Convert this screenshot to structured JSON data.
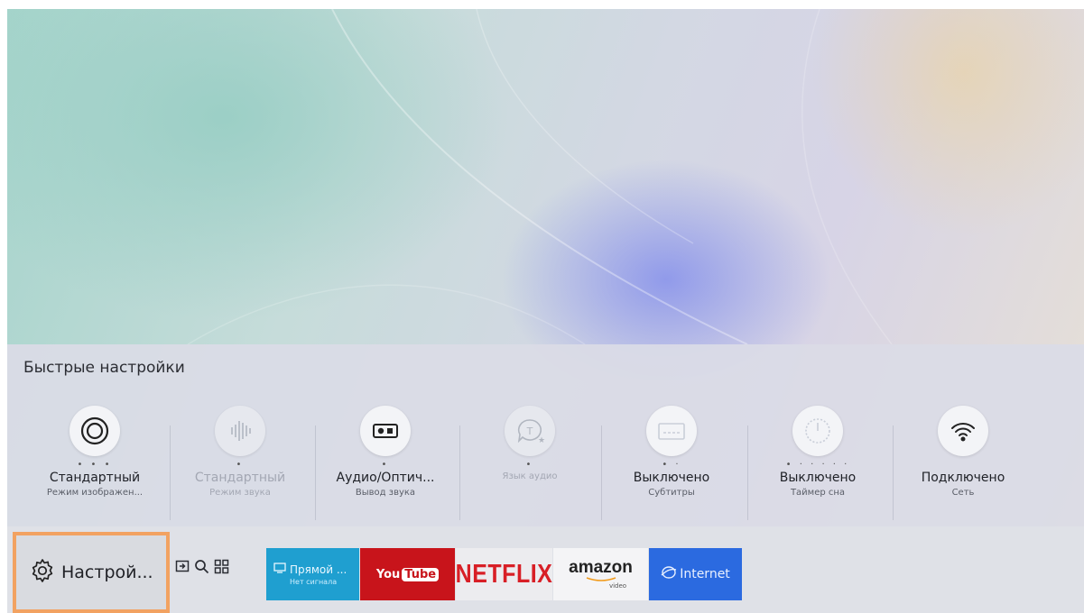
{
  "quick_settings": {
    "title": "Быстрые настройки",
    "items": [
      {
        "value": "Стандартный",
        "label": "Режим изображен...",
        "icon": "picture-mode-icon",
        "dots": "• • •"
      },
      {
        "value": "Стандартный",
        "label": "Режим звука",
        "icon": "sound-mode-icon",
        "dots": "•"
      },
      {
        "value": "Аудио/Оптич...",
        "label": "Вывод звука",
        "icon": "sound-output-icon",
        "dots": "•"
      },
      {
        "value": "",
        "label": "Язык аудио",
        "icon": "audio-language-icon",
        "dots": "•"
      },
      {
        "value": "Выключено",
        "label": "Субтитры",
        "icon": "subtitles-icon",
        "dots": "• ·"
      },
      {
        "value": "Выключено",
        "label": "Таймер сна",
        "icon": "sleep-timer-icon",
        "dots": "• · · · · ·"
      },
      {
        "value": "Подключено",
        "label": "Сеть",
        "icon": "wifi-icon",
        "dots": ""
      }
    ]
  },
  "bottom_bar": {
    "settings_label": "Настрой...",
    "icons": [
      "source-icon",
      "search-icon",
      "apps-icon"
    ],
    "apps": {
      "live": {
        "label": "Прямой ...",
        "sub": "Нет сигнала"
      },
      "youtube": {
        "you": "You",
        "tube": "Tube"
      },
      "netflix": "NETFLIX",
      "amazon": {
        "label": "amazon",
        "sub": "video"
      },
      "internet": "Internet"
    }
  },
  "colors": {
    "focus": "#f2a261",
    "youtube": "#c8141b",
    "netflix": "#d81f26",
    "live": "#1f9fd0",
    "internet": "#2b6ae0"
  }
}
